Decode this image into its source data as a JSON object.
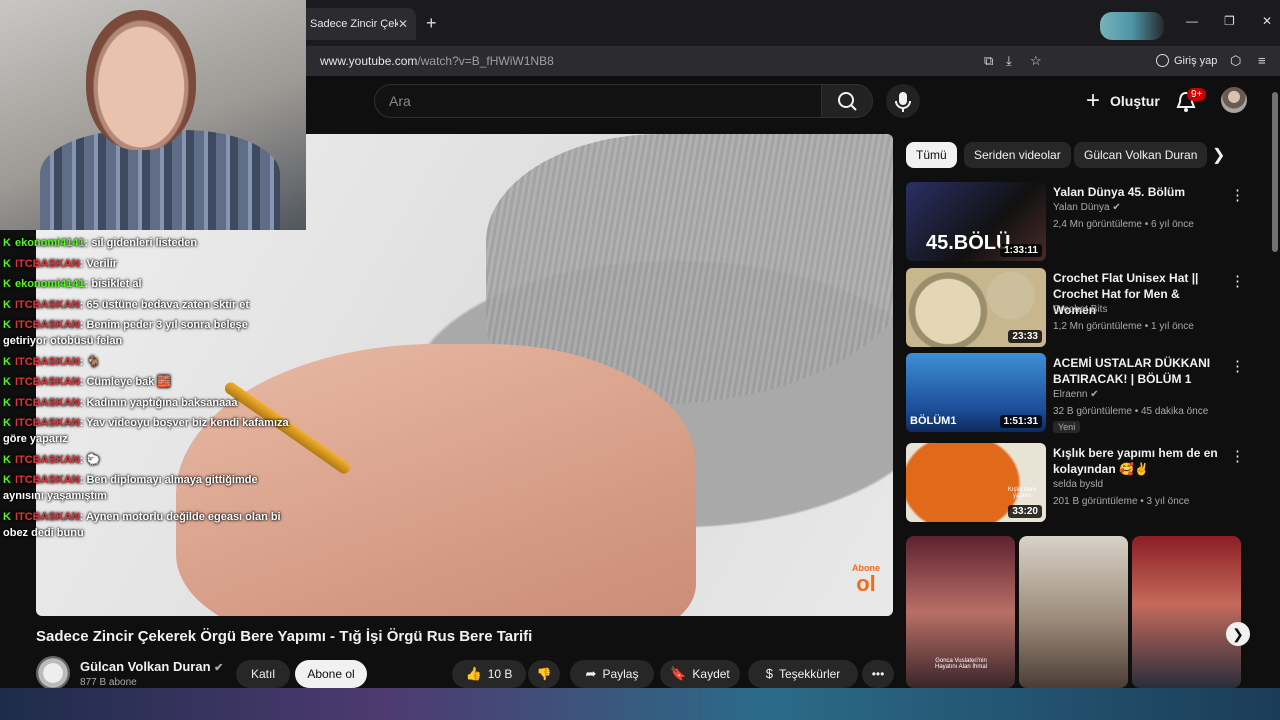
{
  "browser": {
    "tab_title": "Sadece Zincir Çekerek Örgü",
    "tab_close": "✕",
    "new_tab": "+",
    "url_host": "www.youtube.com",
    "url_path": "/watch?v=B_fHWiW1NB8",
    "login_label": "Giriş yap"
  },
  "masthead": {
    "search_placeholder": "Ara",
    "create_label": "Oluştur",
    "notifications_badge": "9+"
  },
  "overlay": {
    "chat": [
      {
        "user": "ekonomi4141",
        "text": ": sil gidenleri listeden",
        "color": "green"
      },
      {
        "user": "ITCBASKAN",
        "text": ": Verilir",
        "color": "red"
      },
      {
        "user": "ekonomi4141",
        "text": ": bisiklet al",
        "color": "green"
      },
      {
        "user": "ITCBASKAN",
        "text": ": 65 üstüne bedava zaten sktir et",
        "color": "red"
      },
      {
        "user": "ITCBASKAN",
        "text": ": Benim peder 3 yıl sonra beleşe getiriyor otobüsü felan",
        "color": "red"
      },
      {
        "user": "ITCBASKAN",
        "text": ": 🐐",
        "color": "red"
      },
      {
        "user": "ITCBASKAN",
        "text": ": Cümleye bak 🧱",
        "color": "red"
      },
      {
        "user": "ITCBASKAN",
        "text": ": Kadının yaptığına baksanaaa",
        "color": "red"
      },
      {
        "user": "ITCBASKAN",
        "text": ": Yav videoyu boşver biz kendi kafamıza göre yaparız",
        "color": "red"
      },
      {
        "user": "ITCBASKAN",
        "text": ": 🐑",
        "color": "red"
      },
      {
        "user": "ITCBASKAN",
        "text": ": Ben diplomayı almaya gittiğimde aynısını yaşamıştım",
        "color": "red"
      },
      {
        "user": "ITCBASKAN",
        "text": ": Aynen motorlu değilde egeası olan bi obez dedi bunu",
        "color": "red"
      }
    ]
  },
  "player": {
    "subscribe_watermark_top": "Abone",
    "subscribe_watermark_bottom": "ol"
  },
  "video": {
    "title": "Sadece Zincir Çekerek Örgü Bere Yapımı - Tığ İşi Örgü Rus Bere Tarifi",
    "channel": "Gülcan Volkan Duran",
    "subscribers": "877 B abone",
    "join_label": "Katıl",
    "subscribe_label": "Abone ol",
    "likes": "10 B",
    "share_label": "Paylaş",
    "save_label": "Kaydet",
    "thanks_label": "Teşekkürler",
    "more_label": "•••"
  },
  "chips": [
    "Tümü",
    "Seriden videolar",
    "Gülcan Volkan Duran"
  ],
  "recommendations": [
    {
      "title": "Yalan Dünya 45. Bölüm",
      "channel": "Yalan Dünya",
      "verified": true,
      "meta": "2,4 Mn görüntüleme • 6 yıl önce",
      "duration": "1:33:11",
      "thumb_text": "45.BÖLÜ"
    },
    {
      "title": "Crochet Flat Unisex Hat || Crochet Hat for Men & Women",
      "channel": "Crochet Bits",
      "verified": false,
      "meta": "1,2 Mn görüntüleme • 1 yıl önce",
      "duration": "23:33",
      "thumb_text": ""
    },
    {
      "title": "ACEMİ USTALAR DÜKKANI BATIRACAK! | BÖLÜM 1",
      "channel": "Elraenn",
      "verified": true,
      "meta": "32 B görüntüleme • 45 dakika önce",
      "duration": "1:51:31",
      "badge": "Yeni",
      "thumb_text": "BÖLÜM1"
    },
    {
      "title": "Kışlık bere yapımı hem de en kolayından 🥰✌️",
      "channel": "selda bysld",
      "verified": false,
      "meta": "201 B görüntüleme • 3 yıl önce",
      "duration": "33:20",
      "thumb_text": "Kışlık bere yapımı"
    }
  ],
  "shorts": [
    {
      "caption": "Gonca Vuslateri'nin Hayatını Alan İhmal"
    },
    {
      "caption": ""
    },
    {
      "caption": ""
    }
  ],
  "colors": {
    "accent_red": "#cc0000",
    "chat_green": "#53fc18",
    "chat_red": "#e0343b",
    "watermark_orange": "#f26b1d"
  }
}
